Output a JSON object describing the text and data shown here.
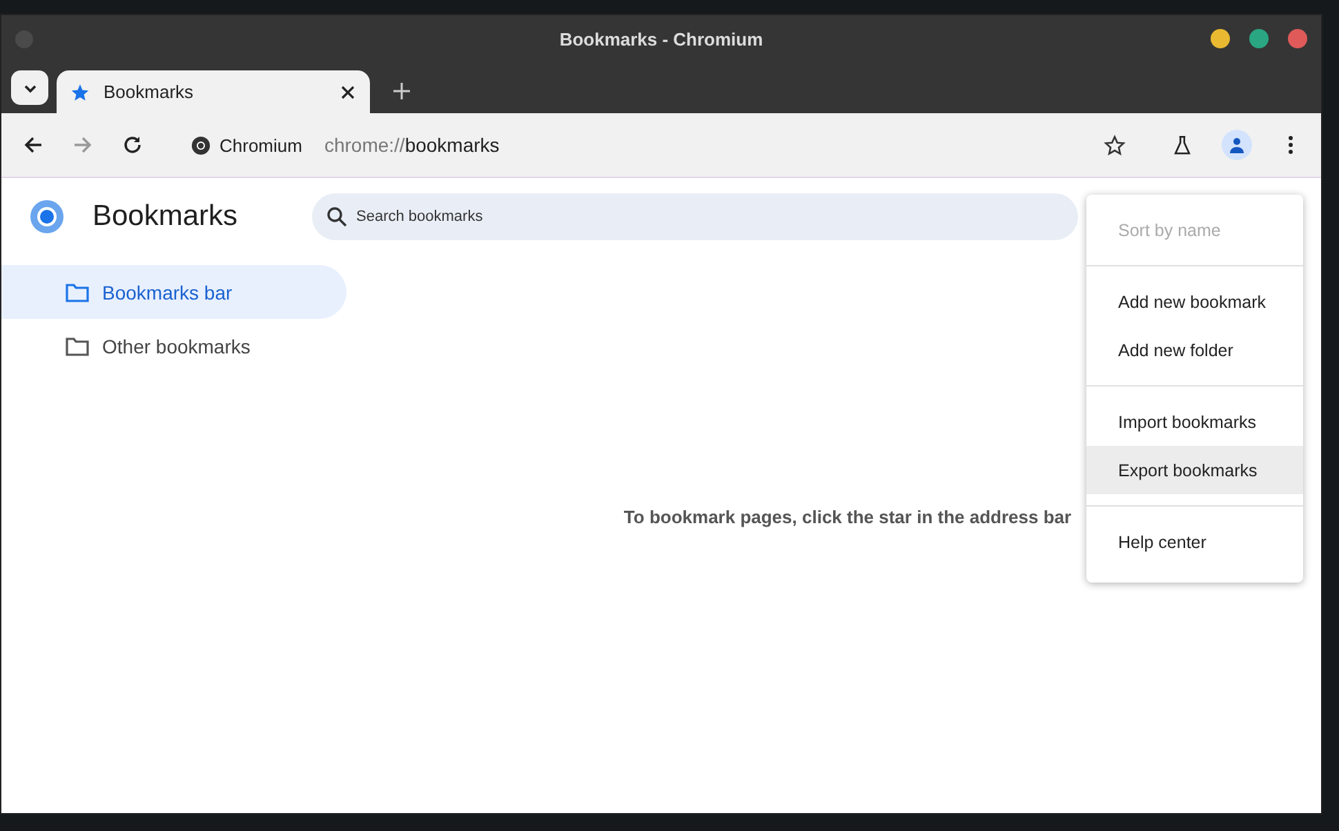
{
  "window": {
    "title": "Bookmarks - Chromium"
  },
  "tabs": [
    {
      "label": "Bookmarks",
      "selected": true
    }
  ],
  "toolbar": {
    "site_chip": "Chromium",
    "url_scheme": "chrome://",
    "url_path": "bookmarks",
    "forward_disabled": true
  },
  "page": {
    "title": "Bookmarks",
    "search": {
      "placeholder": "Search bookmarks"
    },
    "empty_message": "To bookmark pages, click the star in the address bar"
  },
  "sidebar": {
    "items": [
      {
        "label": "Bookmarks bar",
        "selected": true
      },
      {
        "label": "Other bookmarks",
        "selected": false
      }
    ]
  },
  "menu": {
    "groups": [
      [
        {
          "label": "Sort by name",
          "disabled": true,
          "highlighted": false
        }
      ],
      [
        {
          "label": "Add new bookmark",
          "disabled": false,
          "highlighted": false
        },
        {
          "label": "Add new folder",
          "disabled": false,
          "highlighted": false
        }
      ],
      [
        {
          "label": "Import bookmarks",
          "disabled": false,
          "highlighted": false
        },
        {
          "label": "Export bookmarks",
          "disabled": false,
          "highlighted": true
        }
      ],
      [
        {
          "label": "Help center",
          "disabled": false,
          "highlighted": false
        }
      ]
    ]
  }
}
